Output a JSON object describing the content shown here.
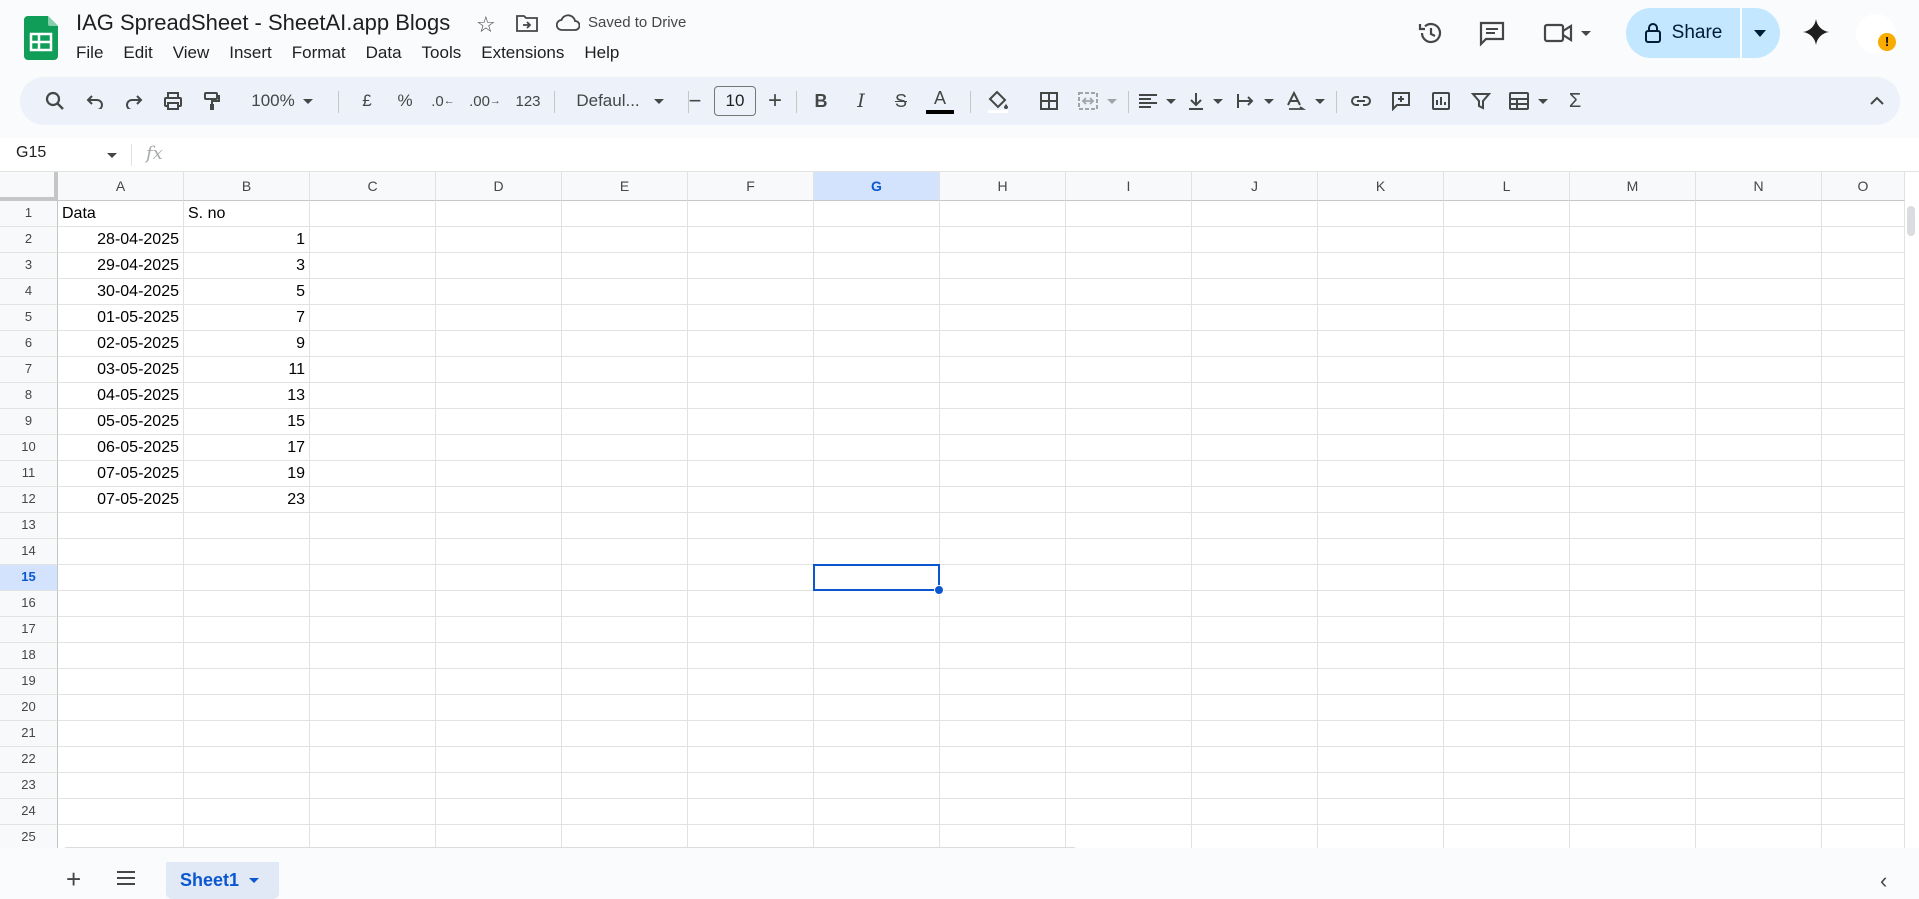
{
  "header": {
    "title": "IAG SpreadSheet - SheetAI.app Blogs",
    "saved_status": "Saved to Drive",
    "menu": [
      "File",
      "Edit",
      "View",
      "Insert",
      "Format",
      "Data",
      "Tools",
      "Extensions",
      "Help"
    ],
    "share_label": "Share",
    "avatar_badge": "!"
  },
  "toolbar": {
    "zoom": "100%",
    "currency": "£",
    "percent": "%",
    "decrease_decimal": ".0",
    "increase_decimal": ".00",
    "number_format": "123",
    "font": "Defaul...",
    "font_size": "10",
    "decrease_font": "−",
    "increase_font": "+",
    "bold": "B",
    "italic": "I",
    "strike": "S",
    "text_color": "A",
    "functions": "Σ"
  },
  "formula_bar": {
    "name_box": "G15",
    "fx": "fx"
  },
  "sheet": {
    "columns": [
      "A",
      "B",
      "C",
      "D",
      "E",
      "F",
      "G",
      "H",
      "I",
      "J",
      "K",
      "L",
      "M",
      "N",
      "O"
    ],
    "selected_column": "G",
    "row_count": 25,
    "selected_row": 15,
    "cells": [
      [
        "Data",
        "S. no"
      ],
      [
        "28-04-2025",
        "1"
      ],
      [
        "29-04-2025",
        "3"
      ],
      [
        "30-04-2025",
        "5"
      ],
      [
        "01-05-2025",
        "7"
      ],
      [
        "02-05-2025",
        "9"
      ],
      [
        "03-05-2025",
        "11"
      ],
      [
        "04-05-2025",
        "13"
      ],
      [
        "05-05-2025",
        "15"
      ],
      [
        "06-05-2025",
        "17"
      ],
      [
        "07-05-2025",
        "19"
      ],
      [
        "07-05-2025",
        "23"
      ]
    ]
  },
  "tabs": {
    "active": "Sheet1"
  },
  "colors": {
    "accent": "#0b57d0",
    "share_bg": "#c2e7ff",
    "sheets_green": "#0f9d58"
  }
}
